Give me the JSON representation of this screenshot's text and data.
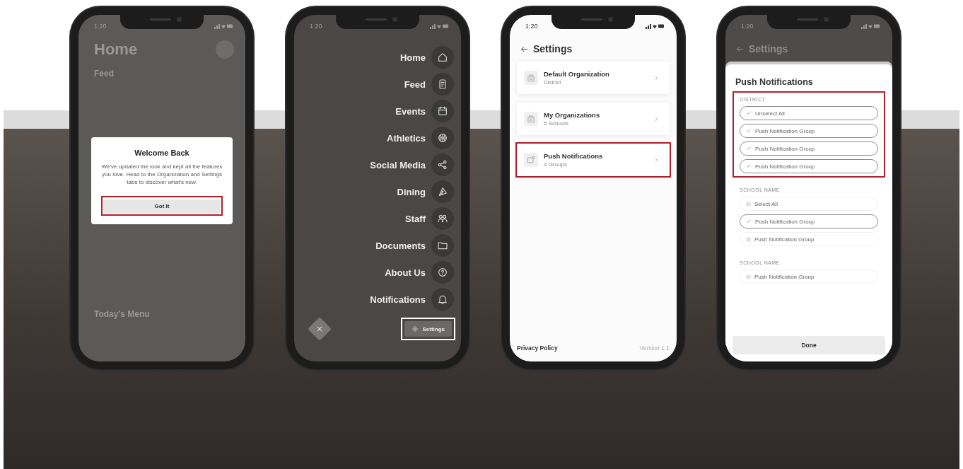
{
  "phones": [
    {
      "kind": "welcome",
      "status_time": "1:20",
      "background": {
        "title": "Home",
        "sections": [
          "Feed",
          "Today's Menu"
        ]
      },
      "dialog": {
        "title": "Welcome Back",
        "message": "We've updated the look and kept all the features you love. Head to the Organization and Settings tabs to discover what's new.",
        "button": "Got It",
        "highlighted": true
      }
    },
    {
      "kind": "menu",
      "status_time": "1:20",
      "items": [
        {
          "label": "Home"
        },
        {
          "label": "Feed"
        },
        {
          "label": "Events"
        },
        {
          "label": "Athletics"
        },
        {
          "label": "Social Media"
        },
        {
          "label": "Dining"
        },
        {
          "label": "Staff"
        },
        {
          "label": "Documents"
        },
        {
          "label": "About Us"
        },
        {
          "label": "Notifications"
        }
      ],
      "settings_button": {
        "label": "Settings",
        "highlighted": true
      }
    },
    {
      "kind": "settings",
      "status_time": "1:20",
      "title": "Settings",
      "rows": [
        {
          "title": "Default Organization",
          "subtitle": "District",
          "highlighted": false
        },
        {
          "title": "My Organizations",
          "subtitle": "5 Schools",
          "highlighted": false
        },
        {
          "title": "Push Notifications",
          "subtitle": "4 Groups",
          "highlighted": true
        }
      ],
      "footer_link": "Privacy Policy",
      "version": "Version 1.1"
    },
    {
      "kind": "push",
      "status_time": "1:20",
      "background_title": "Settings",
      "title": "Push Notifications",
      "groups": [
        {
          "heading": "DISTRICT",
          "highlighted": true,
          "options": [
            {
              "label": "Unselect All",
              "checked": true
            },
            {
              "label": "Push Notification Group",
              "checked": true
            },
            {
              "label": "Push Notification Group",
              "checked": true
            },
            {
              "label": "Push Notification Group",
              "checked": true
            }
          ]
        },
        {
          "heading": "SCHOOL NAME",
          "highlighted": false,
          "options": [
            {
              "label": "Select All",
              "checked": false
            },
            {
              "label": "Push Notification Group",
              "checked": true
            },
            {
              "label": "Push Notification Group",
              "checked": false
            }
          ]
        },
        {
          "heading": "SCHOOL NAME",
          "highlighted": false,
          "options": [
            {
              "label": "Push Notification Group",
              "checked": false
            }
          ]
        }
      ],
      "done": "Done"
    }
  ]
}
